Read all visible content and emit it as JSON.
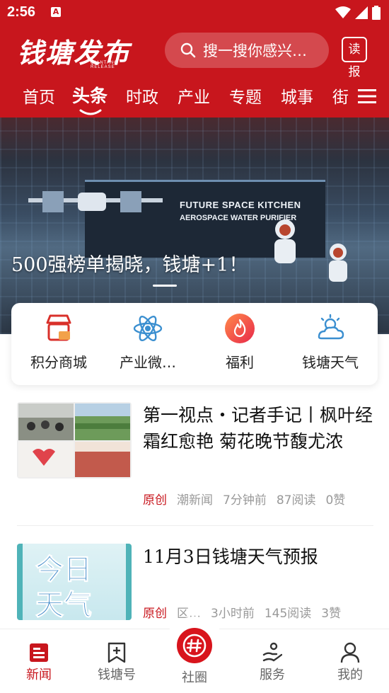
{
  "status_bar": {
    "time": "2:56",
    "notification_glyph": "A"
  },
  "header": {
    "logo_text": "钱塘发布",
    "logo_sub": "QIANTANG RELEASE",
    "search_placeholder": "搜一搜你感兴…",
    "read_label": "读报"
  },
  "tabs": [
    {
      "label": "首页",
      "active": false
    },
    {
      "label": "头条",
      "active": true
    },
    {
      "label": "时政",
      "active": false
    },
    {
      "label": "产业",
      "active": false
    },
    {
      "label": "专题",
      "active": false
    },
    {
      "label": "城事",
      "active": false
    },
    {
      "label": "街",
      "active": false
    }
  ],
  "banner": {
    "caption": "500强榜单揭晓，钱塘+1！",
    "wall_line1": "FUTURE SPACE KITCHEN",
    "wall_line2": "AEROSPACE WATER PURIFIER"
  },
  "quick_links": [
    {
      "label": "积分商城",
      "icon": "shop-icon"
    },
    {
      "label": "产业微…",
      "icon": "atom-icon"
    },
    {
      "label": "福利",
      "icon": "flame-icon"
    },
    {
      "label": "钱塘天气",
      "icon": "weather-icon"
    }
  ],
  "news": [
    {
      "title": "第一视点・记者手记丨枫叶经霜红愈艳 菊花晚节馥尤浓",
      "tag": "原创",
      "source": "潮新闻",
      "time": "7分钟前",
      "reads": "87阅读",
      "likes": "0赞"
    },
    {
      "title": "11月3日钱塘天气预报",
      "tag": "原创",
      "source": "区…",
      "time": "3小时前",
      "reads": "145阅读",
      "likes": "3赞",
      "thumb_text_1": "今日",
      "thumb_text_2": "天气"
    }
  ],
  "bottom_nav": [
    {
      "label": "新闻",
      "active": true
    },
    {
      "label": "钱塘号",
      "active": false
    },
    {
      "label": "社圈",
      "active": false
    },
    {
      "label": "服务",
      "active": false
    },
    {
      "label": "我的",
      "active": false
    }
  ],
  "colors": {
    "brand_red": "#c8161d",
    "text_dark": "#111111",
    "text_muted": "#999999"
  }
}
